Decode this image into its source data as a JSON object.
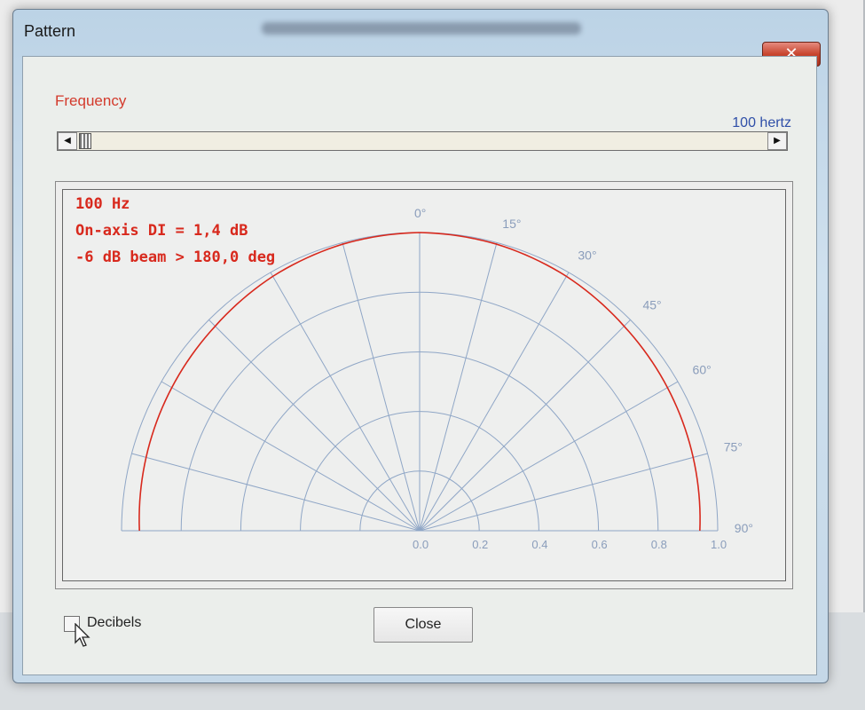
{
  "window": {
    "title": "Pattern",
    "close_glyph": "✕"
  },
  "frequency": {
    "label": "Frequency",
    "value_text": "100 hertz",
    "slider_position_fraction": 0.005
  },
  "plot": {
    "info_lines": [
      "100 Hz",
      "On-axis DI = 1,4 dB",
      "-6 dB beam > 180,0 deg"
    ],
    "angle_labels": [
      "0°",
      "15°",
      "30°",
      "45°",
      "60°",
      "75°",
      "90°"
    ],
    "radial_labels": [
      "0.0",
      "0.2",
      "0.4",
      "0.6",
      "0.8",
      "1.0"
    ],
    "colors": {
      "pattern": "#d8291d",
      "grid": "#8fa6c6",
      "labels": "#8a9dbb"
    }
  },
  "chart_data": {
    "type": "polar",
    "angles_deg": [
      0,
      15,
      30,
      45,
      60,
      75,
      90
    ],
    "radius_ticks": [
      0.0,
      0.2,
      0.4,
      0.6,
      0.8,
      1.0
    ],
    "rlim": [
      0,
      1
    ],
    "series": [
      {
        "angles_deg": [
          -90,
          -75,
          -60,
          -45,
          -30,
          -15,
          0,
          15,
          30,
          45,
          60,
          75,
          90
        ],
        "values": [
          0.94,
          0.95,
          0.96,
          0.97,
          0.985,
          0.995,
          1.0,
          0.995,
          0.985,
          0.97,
          0.96,
          0.95,
          0.94
        ]
      }
    ],
    "grid": true
  },
  "controls": {
    "decibels_label": "Decibels",
    "decibels_checked": false,
    "close_label": "Close",
    "scroll_left_glyph": "◀",
    "scroll_right_glyph": "▶"
  }
}
